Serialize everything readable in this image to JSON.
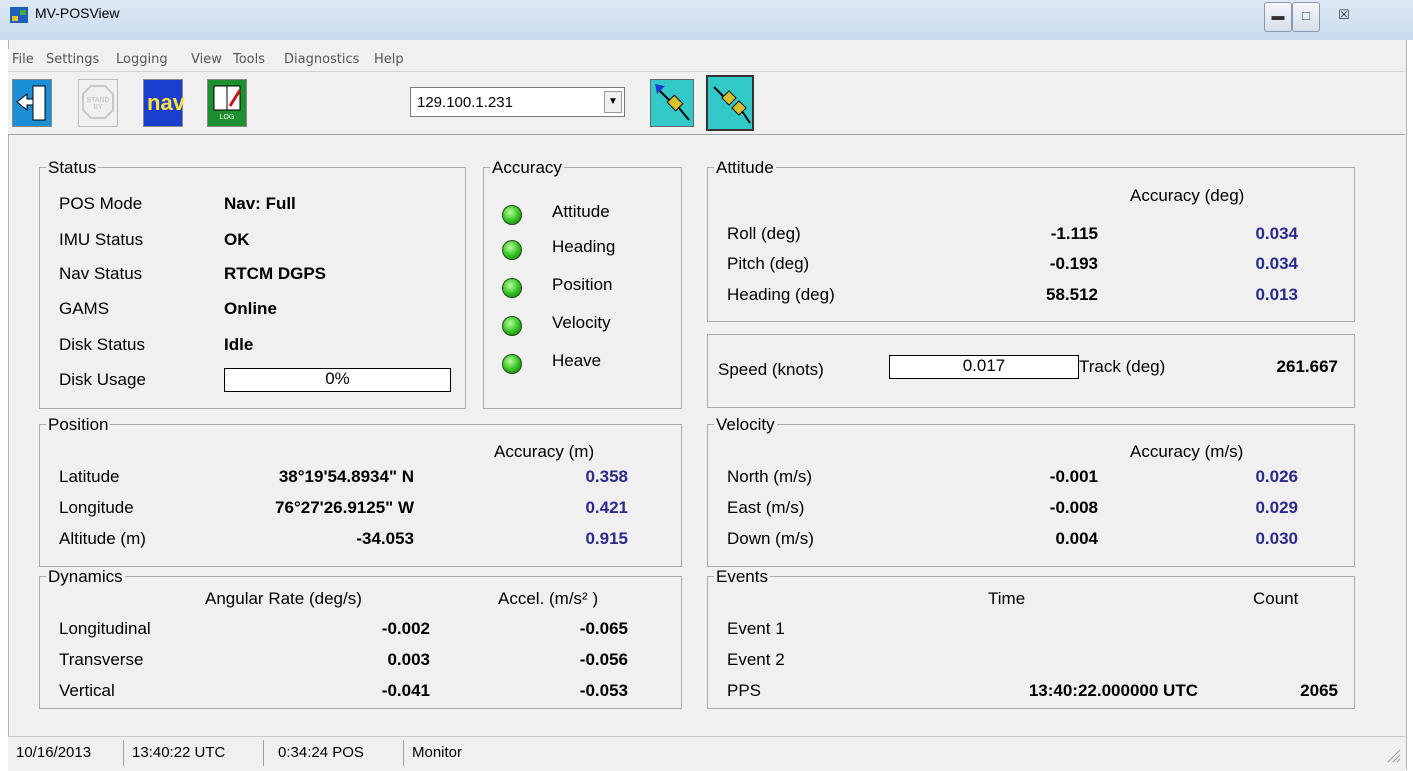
{
  "window": {
    "title": "MV-POSView",
    "buttons": [
      "minimize-button",
      "restore-button",
      "close-button"
    ],
    "close_glyph": "☒"
  },
  "menu": [
    "File",
    "Settings",
    "Logging",
    "View",
    "Tools",
    "Diagnostics",
    "Help"
  ],
  "toolbar": {
    "ip_address": "129.100.1.231",
    "standby_label": "STAND BY",
    "nav_label": "nav",
    "log_label": "LOG"
  },
  "status": {
    "title": "Status",
    "rows": [
      {
        "label": "POS Mode",
        "value": "Nav: Full"
      },
      {
        "label": "IMU Status",
        "value": "OK"
      },
      {
        "label": "Nav Status",
        "value": "RTCM DGPS"
      },
      {
        "label": "GAMS",
        "value": "Online"
      },
      {
        "label": "Disk Status",
        "value": "Idle"
      }
    ],
    "disk_usage_label": "Disk Usage",
    "disk_usage_value": "0%"
  },
  "accuracy": {
    "title": "Accuracy",
    "items": [
      "Attitude",
      "Heading",
      "Position",
      "Velocity",
      "Heave"
    ],
    "led_color": "#2fbf1f"
  },
  "attitude": {
    "title": "Attitude",
    "acc_header": "Accuracy (deg)",
    "rows": [
      {
        "label": "Roll (deg)",
        "value": "-1.115",
        "acc": "0.034"
      },
      {
        "label": "Pitch (deg)",
        "value": "-0.193",
        "acc": "0.034"
      },
      {
        "label": "Heading (deg)",
        "value": "58.512",
        "acc": "0.013"
      }
    ]
  },
  "speed": {
    "speed_label": "Speed (knots)",
    "speed_value": "0.017",
    "track_label": "Track (deg)",
    "track_value": "261.667"
  },
  "position": {
    "title": "Position",
    "acc_header": "Accuracy (m)",
    "rows": [
      {
        "label": "Latitude",
        "value": "38°19'54.8934\" N",
        "acc": "0.358"
      },
      {
        "label": "Longitude",
        "value": "76°27'26.9125\" W",
        "acc": "0.421"
      },
      {
        "label": "Altitude (m)",
        "value": "-34.053",
        "acc": "0.915"
      }
    ]
  },
  "velocity": {
    "title": "Velocity",
    "acc_header": "Accuracy (m/s)",
    "rows": [
      {
        "label": "North (m/s)",
        "value": "-0.001",
        "acc": "0.026"
      },
      {
        "label": "East  (m/s)",
        "value": "-0.008",
        "acc": "0.029"
      },
      {
        "label": "Down (m/s)",
        "value": "0.004",
        "acc": "0.030"
      }
    ]
  },
  "dynamics": {
    "title": "Dynamics",
    "col1": "Angular Rate (deg/s)",
    "col2": "Accel. (m/s² )",
    "rows": [
      {
        "label": "Longitudinal",
        "rate": "-0.002",
        "accel": "-0.065"
      },
      {
        "label": "Transverse",
        "rate": "0.003",
        "accel": "-0.056"
      },
      {
        "label": "Vertical",
        "rate": "-0.041",
        "accel": "-0.053"
      }
    ]
  },
  "events": {
    "title": "Events",
    "time_header": "Time",
    "count_header": "Count",
    "rows": [
      {
        "label": "Event 1",
        "time": "",
        "count": ""
      },
      {
        "label": "Event 2",
        "time": "",
        "count": ""
      },
      {
        "label": "PPS",
        "time": "13:40:22.000000 UTC",
        "count": "2065"
      }
    ]
  },
  "statusbar": [
    "10/16/2013",
    "13:40:22 UTC",
    "0:34:24 POS",
    "Monitor"
  ],
  "colors": {
    "accuracy_value": "#2a2a8a",
    "panel_bg": "#f0f0f0"
  }
}
